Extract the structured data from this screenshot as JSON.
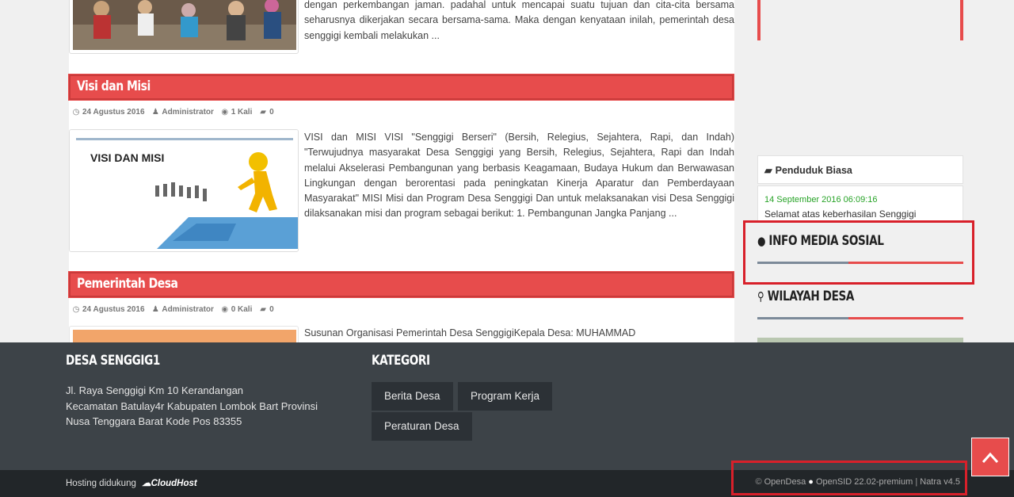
{
  "articles": [
    {
      "excerpt": "dengan perkembangan jaman. padahal untuk mencapai suatu tujuan dan cita-cita bersama seharusnya dikerjakan secara bersama-sama.    Maka dengan kenyataan inilah, pemerintah desa senggigi kembali melakukan ..."
    },
    {
      "title": "Visi dan Misi",
      "date": "24 Agustus 2016",
      "author": "Administrator",
      "views": "1 Kali",
      "comments": "0",
      "thumb_text": "VISI DAN MISI",
      "excerpt": "VISI dan MISI   VISI   \"Senggigi Berseri\"  (Bersih, Relegius, Sejahtera, Rapi, dan Indah)   \"Terwujudnya masyarakat Desa Senggigi yang Bersih, Relegius, Sejahtera, Rapi dan Indah melalui Akselerasi Pembangunan yang berbasis Keagamaan, Budaya Hukum dan Berwawasan Lingkungan dengan berorentasi pada peningkatan Kinerja Aparatur dan Pemberdayaan Masyarakat\"    MISI Misi dan Program Desa Senggigi Dan untuk melaksanakan visi Desa Senggigi dilaksanakan misi dan program sebagai berikut: 1. Pembangunan Jangka Panjang   ..."
    },
    {
      "title": "Pemerintah Desa",
      "date": "24 Agustus 2016",
      "author": "Administrator",
      "views": "0 Kali",
      "comments": "0",
      "excerpt": "Susunan Organisasi Pemerintah Desa SenggigiKepala Desa: MUHAMMAD"
    }
  ],
  "sidebar": {
    "penduduk_title": "Penduduk Biasa",
    "penduduk_date": "14 September 2016 06:09:16",
    "penduduk_text": "Selamat atas keberhasilan Senggigi",
    "info_media_title": "INFO MEDIA SOSIAL",
    "wilayah_title": "WILAYAH DESA"
  },
  "footer": {
    "site_title": "DESA SENGGIG1",
    "address_lines": [
      "Jl. Raya Senggigi Km 10 Kerandangan",
      "Kecamatan Batulay4r Kabupaten Lombok Bart Provinsi",
      "Nusa Tenggara Barat Kode Pos 83355"
    ],
    "kategori_title": "KATEGORI",
    "categories": [
      "Berita Desa",
      "Program Kerja",
      "Peraturan Desa"
    ],
    "hosting_label": "Hosting didukung",
    "hosting_logo_text": "CloudHost",
    "credit_opendesa": "OpenDesa",
    "credit_opensid": "OpenSID 22.02-premium",
    "credit_sep": "|",
    "credit_theme": "Natra v4.5"
  },
  "colors": {
    "accent_red": "#e74c4c",
    "footer_bg": "#3d4348",
    "bottom_bar_bg": "#222629",
    "highlight_box": "#d8202a"
  },
  "icons": {
    "calendar": "clock-icon",
    "author": "user-icon",
    "views": "eye-icon",
    "comments": "comment-icon",
    "globe": "globe-icon",
    "map_marker": "map-marker-icon",
    "scroll_top": "chevron-up-icon"
  }
}
